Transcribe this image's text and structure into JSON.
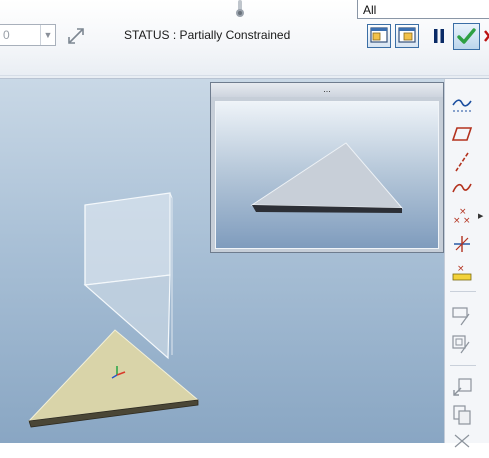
{
  "toolbar": {
    "value_field": "0",
    "status": "STATUS : Partially Constrained",
    "filter_value": "All"
  },
  "preview_window": {
    "title": "..."
  },
  "colors": {
    "viewport_top": "#c9d8e6",
    "viewport_bottom": "#89a6c3",
    "accent": "#3a6ea5",
    "ok_check": "#2ea043"
  },
  "icons": {
    "sidebar": [
      "datum-curve-icon",
      "datum-plane-icon",
      "datum-axis-icon",
      "sketch-curve-icon",
      "point-pattern-icon",
      "coordinate-system-icon",
      "analysis-icon",
      "assemble-component-icon",
      "copy-component-icon",
      "insert-component-icon",
      "paste-icon",
      "mirror-icon"
    ]
  }
}
